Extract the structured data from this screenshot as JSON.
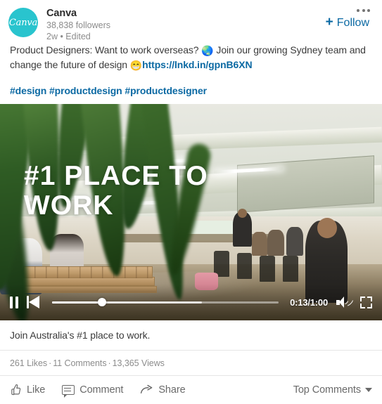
{
  "header": {
    "actor_name": "Canva",
    "avatar_text": "Canva",
    "avatar_color": "#29c4ce",
    "followers": "38,838 followers",
    "timestamp": "2w • Edited",
    "follow_label": "Follow",
    "plus_symbol": "+",
    "menu_icon": "overflow-menu-icon",
    "accent_color": "#0b69a3"
  },
  "commentary": {
    "part1": "Product Designers: Want to work overseas? ",
    "globe_emoji": "🌏",
    "part2": " Join our growing Sydney team and change the future of design ",
    "grin_emoji": "😁",
    "link_text": "https://lnkd.in/gpnB6XN",
    "hashtags": "#design #productdesign #productdesigner"
  },
  "video": {
    "overlay_title": "#1 PLACE TO WORK",
    "caption": "Join Australia's #1 place to work.",
    "controls": {
      "pause_icon": "pause-icon",
      "previous_icon": "previous-track-icon",
      "time_display": "0:13/1:00",
      "current_time": "0:13",
      "duration": "1:00",
      "progress_percent": 22,
      "buffer_percent": 66,
      "volume_icon": "volume-on-icon",
      "fullscreen_icon": "fullscreen-icon"
    }
  },
  "social": {
    "likes": "261 Likes",
    "comments": "11 Comments",
    "views": "13,365 Views",
    "separator": "·"
  },
  "actions": {
    "like": "Like",
    "comment": "Comment",
    "share": "Share",
    "top_comments": "Top Comments"
  }
}
